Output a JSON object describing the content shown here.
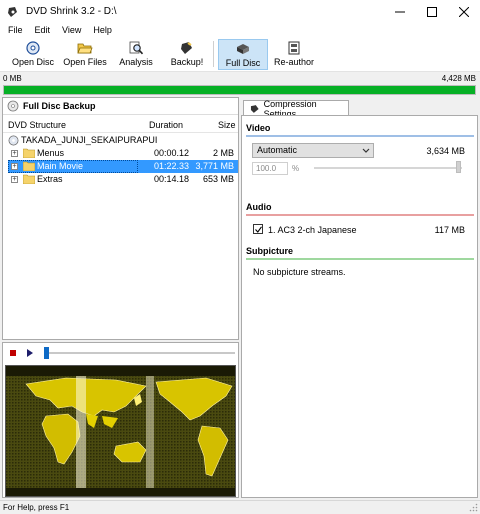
{
  "window": {
    "title": "DVD Shrink 3.2 - D:\\"
  },
  "menu": [
    "File",
    "Edit",
    "View",
    "Help"
  ],
  "toolbar": {
    "open_disc": "Open Disc",
    "open_files": "Open Files",
    "analysis": "Analysis",
    "backup": "Backup!",
    "full_disc": "Full Disc",
    "reauthor": "Re-author"
  },
  "size": {
    "left": "0 MB",
    "right": "4,428 MB",
    "progress_fraction": 1.0
  },
  "left_panel": {
    "title": "Full Disc Backup",
    "columns": {
      "structure": "DVD Structure",
      "duration": "Duration",
      "size": "Size"
    },
    "disc_name": "TAKADA_JUNJI_SEKAIPURAPUI",
    "items": [
      {
        "name": "Menus",
        "duration": "00:00.12",
        "size": "2 MB"
      },
      {
        "name": "Main Movie",
        "duration": "01:22.33",
        "size": "3,771 MB"
      },
      {
        "name": "Extras",
        "duration": "00:14.18",
        "size": "653 MB"
      }
    ]
  },
  "player": {
    "seek_fraction": 0.0
  },
  "right_panel": {
    "tab": "Compression Settings",
    "video": {
      "heading": "Video",
      "mode": "Automatic",
      "size": "3,634 MB",
      "percent": "100.0",
      "percent_sign": "%"
    },
    "audio": {
      "heading": "Audio",
      "tracks": [
        {
          "label": "1. AC3 2-ch Japanese",
          "size": "117 MB",
          "checked": true
        }
      ]
    },
    "subpicture": {
      "heading": "Subpicture",
      "message": "No subpicture streams."
    }
  },
  "status": {
    "text": "For Help, press F1"
  },
  "colors": {
    "progress": "#06b025",
    "selection": "#3399ff",
    "video_line": "#9fbfe6",
    "audio_line": "#e8a0a0",
    "subpicture_line": "#9fd89f",
    "map_land": "#d8c400",
    "map_sea": "#3a3a0a"
  }
}
